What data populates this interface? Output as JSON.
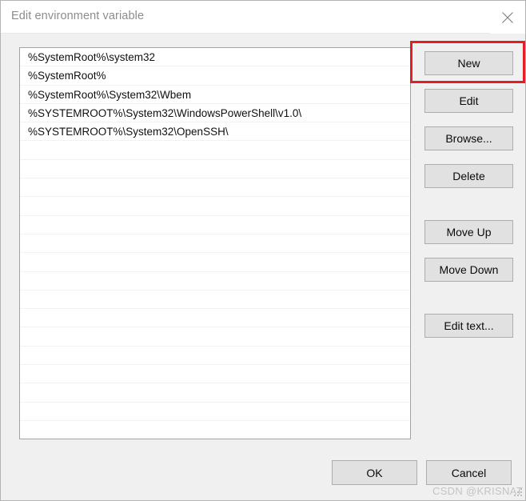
{
  "window": {
    "title": "Edit environment variable",
    "close_icon": "close-icon"
  },
  "list": {
    "items": [
      "%SystemRoot%\\system32",
      "%SystemRoot%",
      "%SystemRoot%\\System32\\Wbem",
      "%SYSTEMROOT%\\System32\\WindowsPowerShell\\v1.0\\",
      "%SYSTEMROOT%\\System32\\OpenSSH\\"
    ],
    "empty_row_count": 15,
    "visible_row_count": 20
  },
  "side_buttons": {
    "new": "New",
    "edit": "Edit",
    "browse": "Browse...",
    "delete": "Delete",
    "move_up": "Move Up",
    "move_down": "Move Down",
    "edit_text": "Edit text..."
  },
  "footer": {
    "ok": "OK",
    "cancel": "Cancel"
  },
  "annotation": {
    "highlight_target": "New",
    "highlight_color": "#e31e24"
  },
  "watermark": {
    "text": "CSDN @KRISNAT"
  },
  "colors": {
    "dialog_background": "#f0f0f0",
    "titlebar_background": "#ffffff",
    "title_text": "#8d8d91",
    "listbox_background": "#ffffff",
    "listbox_border": "#a0a3a8",
    "button_face": "#e1e1e1",
    "button_border": "#adadad",
    "highlight": "#e31e24",
    "watermark_text": "#c3c3c3"
  }
}
